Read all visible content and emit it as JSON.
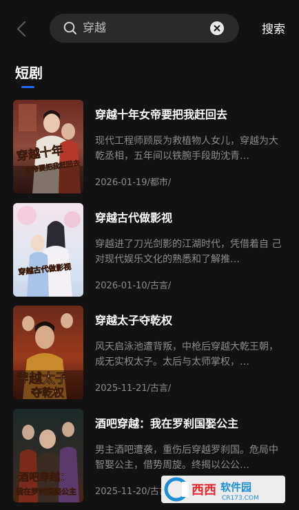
{
  "search": {
    "query": "穿越",
    "action_label": "搜索"
  },
  "section": {
    "title": "短剧"
  },
  "results": [
    {
      "title": "穿越十年女帝要把我赶回去",
      "description": "现代工程师顾辰为救植物人女儿，穿越为大乾丞相，五年间以铁腕手段助沈青…",
      "meta": "2026-01-19/都市/",
      "poster_text": "穿越十年",
      "poster_subtext": "女帝要把我赶回去"
    },
    {
      "title": "穿越古代做影视",
      "description": "穿越进了刀光剑影的江湖时代，凭借着自 己对现代娱乐文化的熟悉和了解推…",
      "meta": "2026-01-10/古言/",
      "poster_text": "穿越古代做影视"
    },
    {
      "title": "穿越太子夺乾权",
      "description": "风天启泳池遭背叛，中枪后穿越大乾王朝，成无实权太子。太后与太师掌权，…",
      "meta": "2025-11-21/古言/",
      "poster_text": "穿越太子",
      "poster_subtext": "夺乾权"
    },
    {
      "title": "酒吧穿越：我在罗刹国娶公主",
      "description": "男主酒吧遭袭，重伤后穿越罗刹国。危局中智娶公主，借势周旋。终揭以公公…",
      "meta": "2025-11-20/古言/",
      "poster_text": "酒吧穿越：",
      "poster_subtext": "我在罗刹国娶公主"
    }
  ],
  "watermark": {
    "text": "西西软件园",
    "domain": "CR173.COM"
  },
  "icons": {
    "back": "chevron-left-icon",
    "search": "search-icon",
    "clear": "close-circle-icon"
  },
  "colors": {
    "background": "#121212",
    "accent": "#1f6cff",
    "search_box": "#2a2a2a",
    "muted_text": "#8c8c8c"
  }
}
